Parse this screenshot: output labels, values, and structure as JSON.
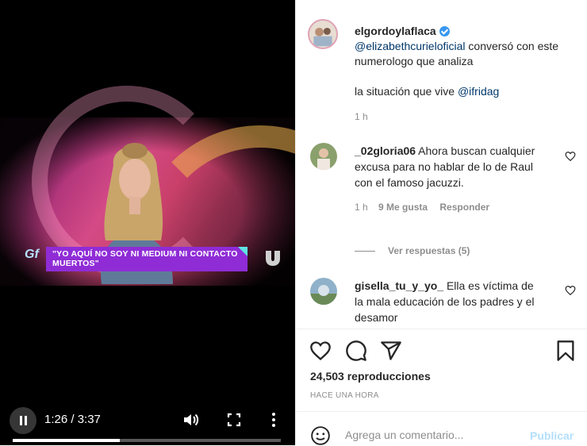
{
  "video": {
    "caption_banner": "\"YO AQUÍ NO SOY NI MEDIUM NI CONTACTO MUERTOS\"",
    "logo_text": "Gf",
    "current_time": "1:26 / 3:37",
    "progress": 0.4
  },
  "post": {
    "username": "elgordoylaflaca",
    "mention1": "@elizabethcurieloficial",
    "text1": " conversó con este numerologo que analiza",
    "text2": "la situación que vive ",
    "mention2": "@ifridag",
    "time": "1 h"
  },
  "comments": [
    {
      "username": "_02gloria06",
      "text": " Ahora buscan cualquier excusa para no hablar de lo de Raul con el famoso jacuzzi.",
      "time": "1 h",
      "likes": "9 Me gusta",
      "reply": "Responder",
      "view_replies": "Ver respuestas (5)"
    },
    {
      "username": "gisella_tu_y_yo_",
      "text": " Ella es víctima de la mala educación de los padres y el desamor"
    }
  ],
  "stats": {
    "views": "24,503 reproducciones",
    "timestamp": "HACE UNA HORA"
  },
  "input": {
    "placeholder": "Agrega un comentario...",
    "post_label": "Publicar"
  },
  "icons": {
    "like": "heart-icon",
    "comment": "comment-icon",
    "share": "share-icon",
    "save": "bookmark-icon",
    "emoji": "emoji-icon",
    "pause": "pause-icon",
    "volume": "volume-icon",
    "fullscreen": "fullscreen-icon",
    "more": "more-icon"
  },
  "colors": {
    "mention": "#00376b",
    "banner": "#8f2cd6",
    "post_disabled": "#b2dffc"
  }
}
